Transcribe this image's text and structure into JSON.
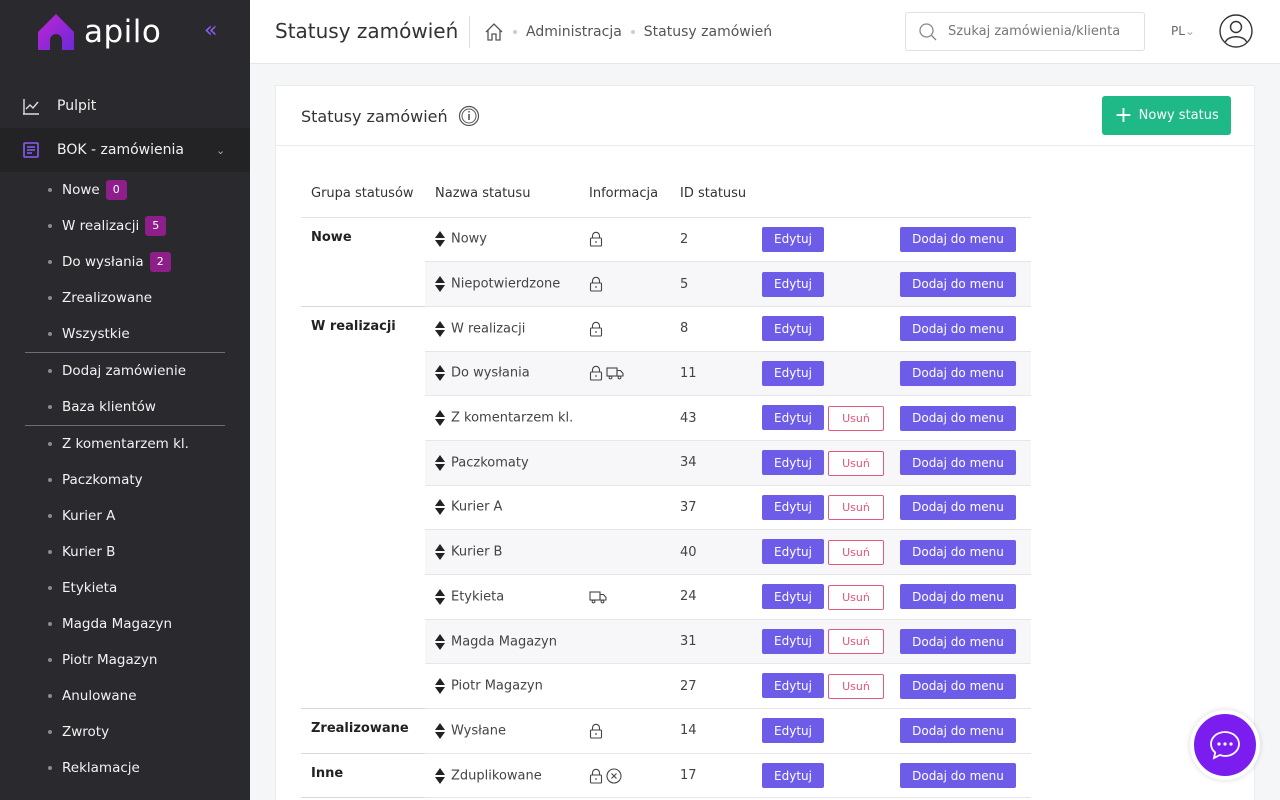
{
  "app": {
    "logo_text": "apilo",
    "collapse_label": "«"
  },
  "sidebar": {
    "main_items": [
      {
        "label": "Pulpit",
        "icon": "chart-icon"
      },
      {
        "label": "BOK - zamówienia",
        "icon": "orders-icon"
      }
    ],
    "group1": [
      {
        "label": "Nowe",
        "badge": "0"
      },
      {
        "label": "W realizacji",
        "badge": "5"
      },
      {
        "label": "Do wysłania",
        "badge": "2"
      },
      {
        "label": "Zrealizowane"
      },
      {
        "label": "Wszystkie"
      }
    ],
    "group2": [
      {
        "label": "Dodaj zamówienie"
      },
      {
        "label": "Baza klientów"
      }
    ],
    "group3": [
      {
        "label": "Z komentarzem kl."
      },
      {
        "label": "Paczkomaty"
      },
      {
        "label": "Kurier A"
      },
      {
        "label": "Kurier B"
      },
      {
        "label": "Etykieta"
      },
      {
        "label": "Magda Magazyn"
      },
      {
        "label": "Piotr Magazyn"
      },
      {
        "label": "Anulowane"
      },
      {
        "label": "Zwroty"
      },
      {
        "label": "Reklamacje"
      }
    ]
  },
  "topbar": {
    "title": "Statusy zamówień",
    "breadcrumb": [
      "Administracja",
      "Statusy zamówień"
    ],
    "search_placeholder": "Szukaj zamówienia/klienta",
    "lang": "PL"
  },
  "card": {
    "title": "Statusy zamówień",
    "new_button": "Nowy status",
    "columns": [
      "Grupa statusów",
      "Nazwa statusu",
      "Informacja",
      "ID statusu"
    ],
    "edit_label": "Edytuj",
    "delete_label": "Usuń",
    "menu_label": "Dodaj do menu",
    "groups": [
      {
        "name": "Nowe",
        "rows": [
          {
            "name": "Nowy",
            "id": "2",
            "lock": true,
            "truck": false,
            "x": false,
            "deletable": false
          },
          {
            "name": "Niepotwierdzone",
            "id": "5",
            "lock": true,
            "truck": false,
            "x": false,
            "deletable": false
          }
        ]
      },
      {
        "name": "W realizacji",
        "rows": [
          {
            "name": "W realizacji",
            "id": "8",
            "lock": true,
            "truck": false,
            "x": false,
            "deletable": false
          },
          {
            "name": "Do wysłania",
            "id": "11",
            "lock": true,
            "truck": true,
            "x": false,
            "deletable": false
          },
          {
            "name": "Z komentarzem kl.",
            "id": "43",
            "lock": false,
            "truck": false,
            "x": false,
            "deletable": true
          },
          {
            "name": "Paczkomaty",
            "id": "34",
            "lock": false,
            "truck": false,
            "x": false,
            "deletable": true
          },
          {
            "name": "Kurier A",
            "id": "37",
            "lock": false,
            "truck": false,
            "x": false,
            "deletable": true
          },
          {
            "name": "Kurier B",
            "id": "40",
            "lock": false,
            "truck": false,
            "x": false,
            "deletable": true
          },
          {
            "name": "Etykieta",
            "id": "24",
            "lock": false,
            "truck": true,
            "x": false,
            "deletable": true
          },
          {
            "name": "Magda Magazyn",
            "id": "31",
            "lock": false,
            "truck": false,
            "x": false,
            "deletable": true
          },
          {
            "name": "Piotr Magazyn",
            "id": "27",
            "lock": false,
            "truck": false,
            "x": false,
            "deletable": true
          }
        ]
      },
      {
        "name": "Zrealizowane",
        "rows": [
          {
            "name": "Wysłane",
            "id": "14",
            "lock": true,
            "truck": false,
            "x": false,
            "deletable": false
          }
        ]
      },
      {
        "name": "Inne",
        "rows": [
          {
            "name": "Zduplikowane",
            "id": "17",
            "lock": true,
            "truck": false,
            "x": true,
            "deletable": false
          }
        ]
      }
    ]
  },
  "colors": {
    "accent": "#6c5ce7",
    "success": "#1fb887",
    "danger": "#e05a7e",
    "badge": "#8e1f8a",
    "sidebar_bg": "#2a2a2e",
    "chat": "#7c1df0"
  }
}
